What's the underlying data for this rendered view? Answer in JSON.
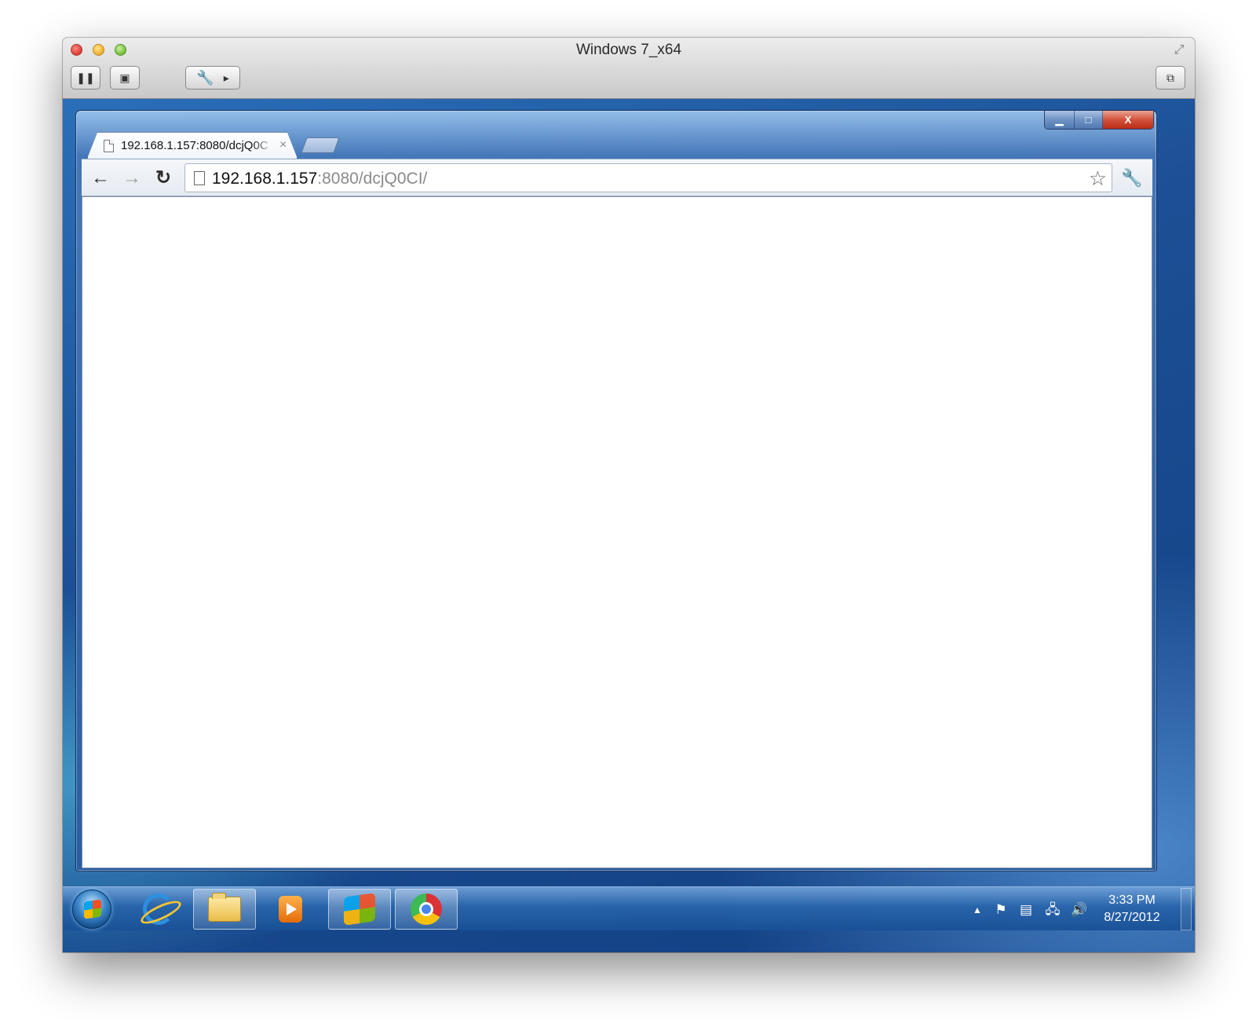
{
  "vm_window": {
    "title": "Windows 7_x64",
    "toolbar": {
      "pause_icon": "pause-icon",
      "snapshot_icon": "snapshot-icon",
      "settings_icon": "wrench-icon",
      "window_icon": "window-mode-icon"
    }
  },
  "browser": {
    "tab": {
      "title": "192.168.1.157:8080/dcjQ0C",
      "close_glyph": "×"
    },
    "address_bar": {
      "host": "192.168.1.157",
      "path": ":8080/dcjQ0CI/"
    },
    "caption": {
      "minimize": "▁",
      "maximize": "□",
      "close": "X"
    }
  },
  "taskbar": {
    "apps": [
      {
        "name": "Internet Explorer",
        "icon": "ie-icon"
      },
      {
        "name": "Windows Explorer",
        "icon": "folder-icon"
      },
      {
        "name": "Windows Media Player",
        "icon": "media-player-icon"
      },
      {
        "name": "Windows Mobility Center",
        "icon": "windows-logo-icon"
      },
      {
        "name": "Google Chrome",
        "icon": "chrome-icon"
      }
    ],
    "clock": {
      "time": "3:33 PM",
      "date": "8/27/2012"
    }
  },
  "colors": {
    "desktop": "#1c4f95",
    "taskbar": "#2864aa",
    "close_button": "#d3523b"
  }
}
